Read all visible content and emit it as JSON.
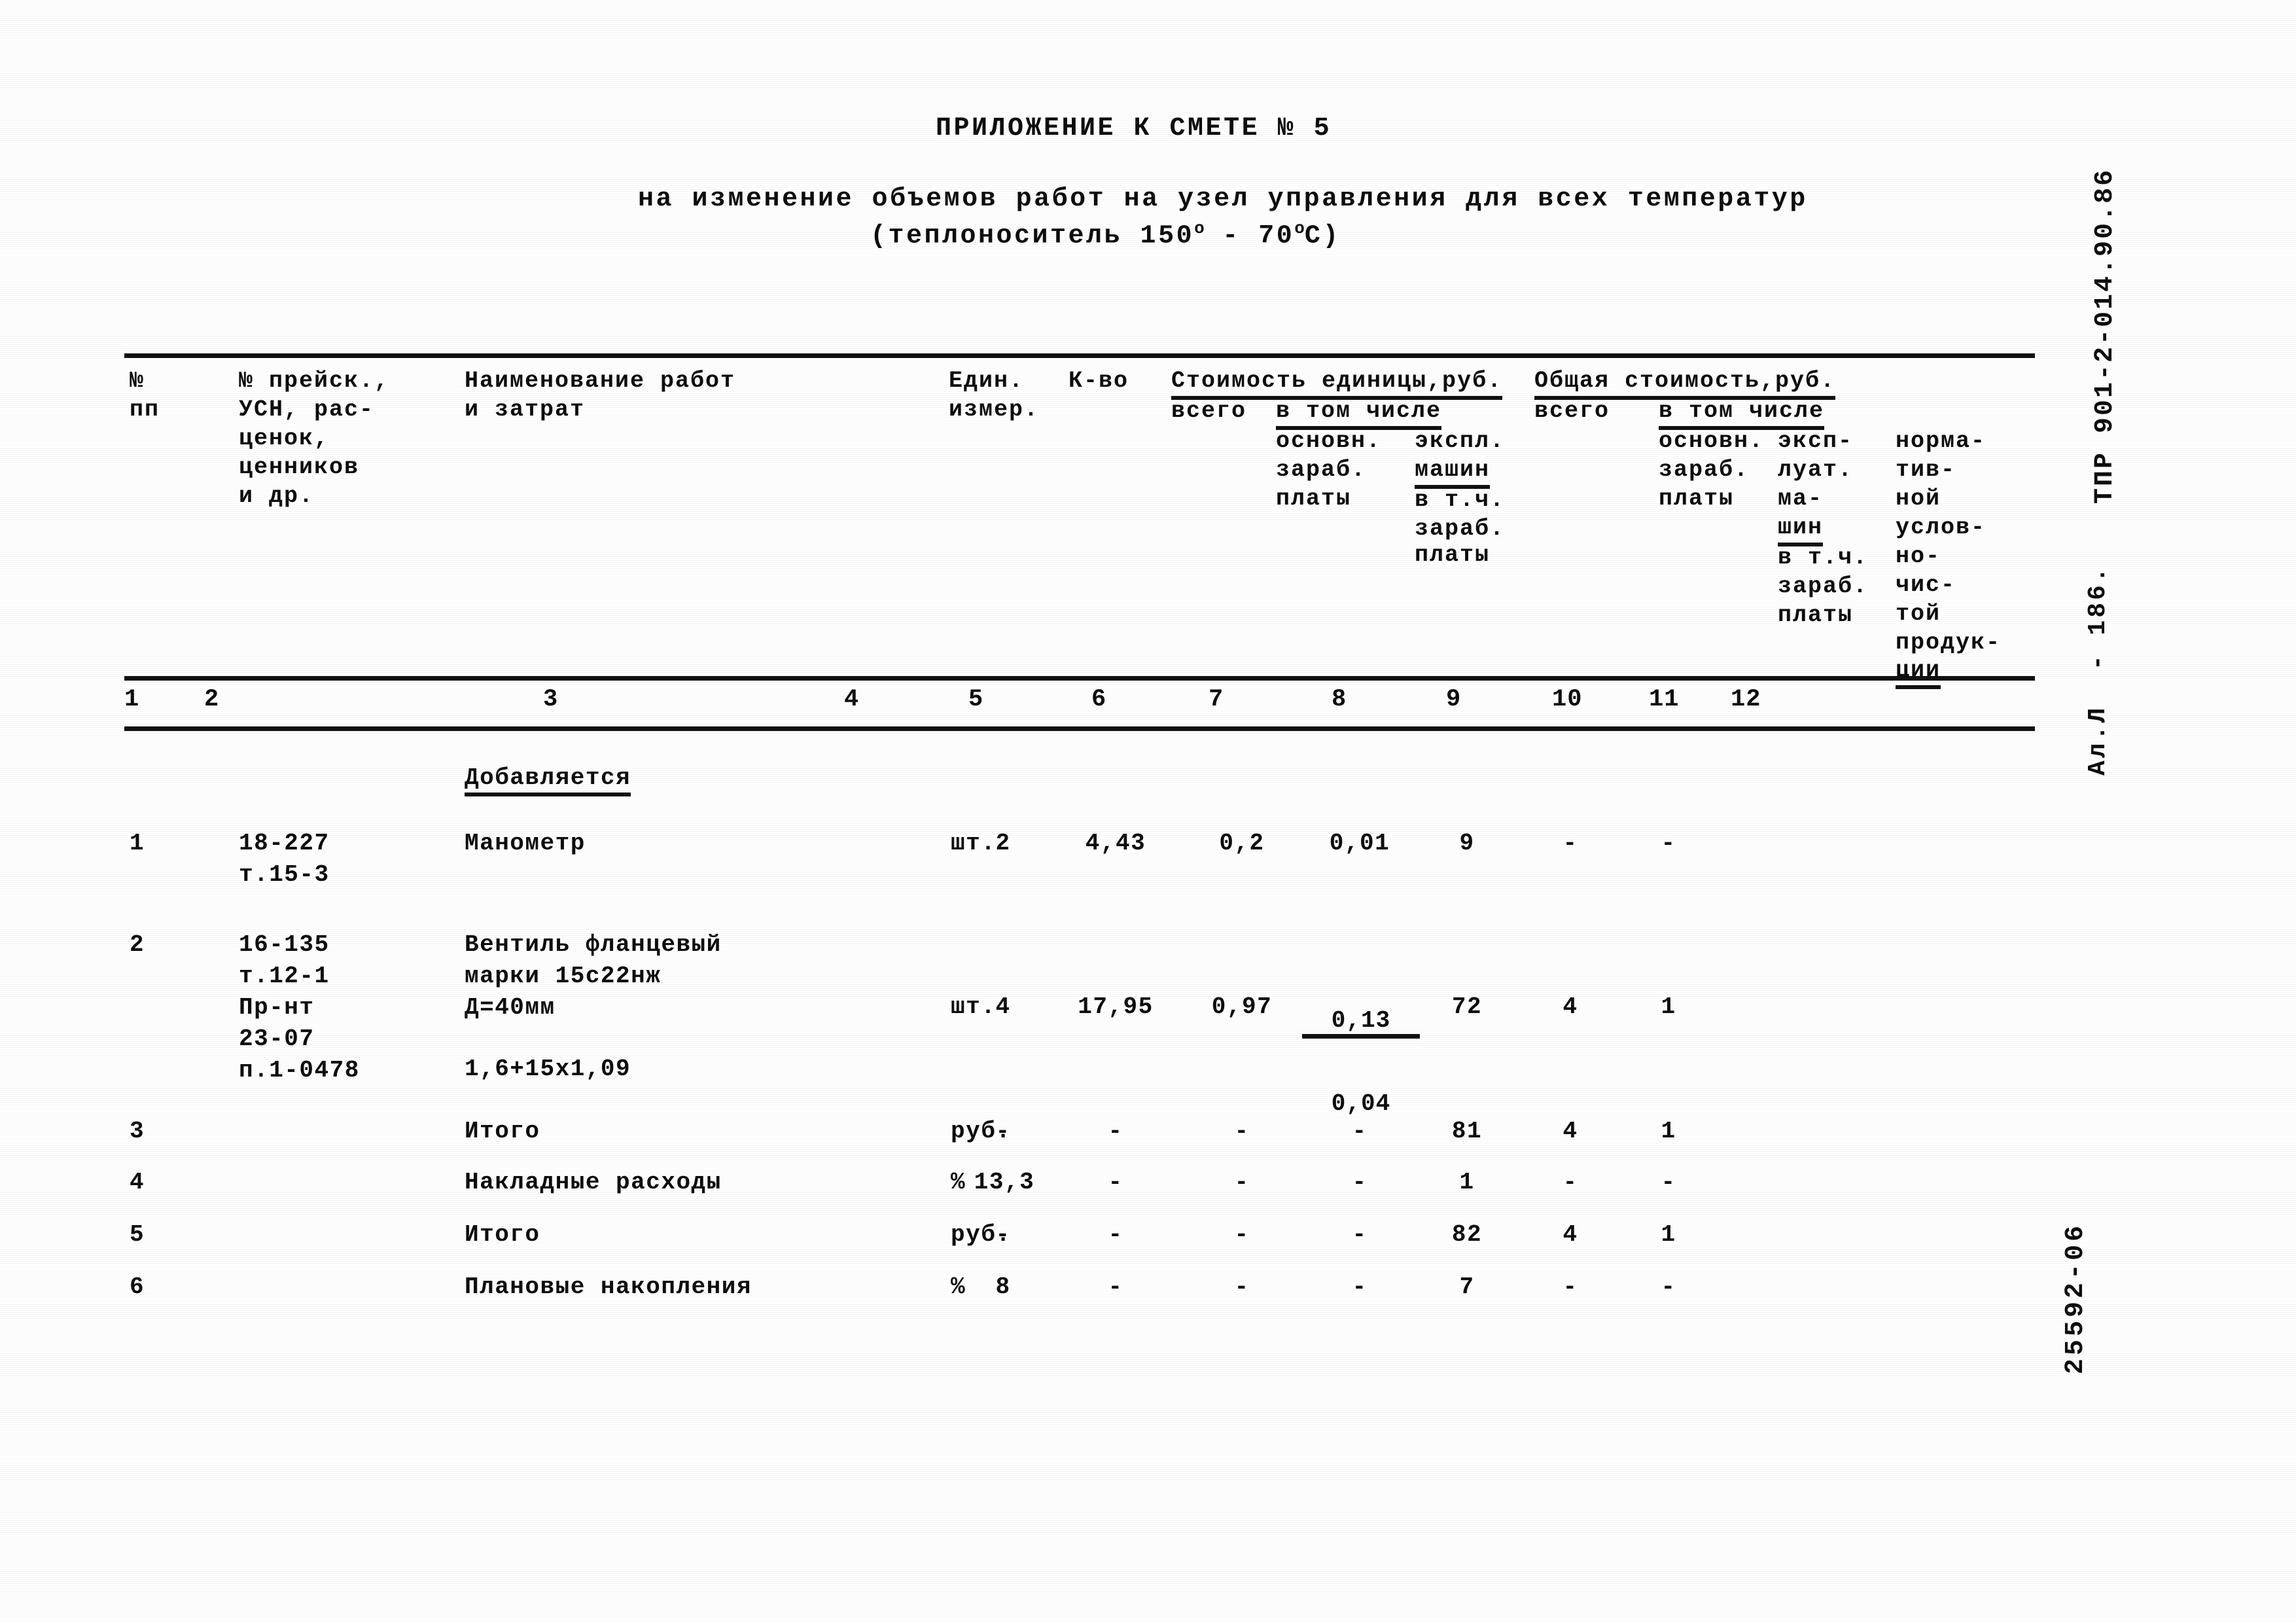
{
  "document": {
    "title": "ПРИЛОЖЕНИЕ К СМЕТЕ № 5",
    "subtitle_line1": "на изменение объемов работ на узел управления для всех температур",
    "subtitle_line2_pre": "(теплоноситель 150",
    "subtitle_line2_mid": " - 70",
    "subtitle_line2_post": "С)",
    "degree": "о"
  },
  "stamps": {
    "code": "ТПР 901-2-014.90.86",
    "album": "Ал.Л  - 186.",
    "archive": "25592-06"
  },
  "table": {
    "header": {
      "col1": "№\nпп",
      "col2": "№ прейск.,\nУСН, рас-\nценок,\nценников\nи др.",
      "col3": "Наименование работ\nи затрат",
      "col4": "Един.\nизмер.",
      "col5": "К-во",
      "group_unit_cost": "Стоимость единицы,руб.",
      "group_total_cost": "Общая стоимость,руб.",
      "col6": "всего",
      "unit_in_which": "в том числе",
      "col7": "основн.\nзараб.\nплаты",
      "col8_l1": "экспл.",
      "col8_l2": "машин",
      "col8_l3": "в т.ч.",
      "col8_l4": "зараб.",
      "col8_l5": "платы",
      "col9": "всего",
      "total_in_which": "в том числе",
      "col10_l1": "основн.",
      "col10_l2": "зараб.",
      "col10_l3": "платы",
      "col11_l1": "эксп-",
      "col11_l2": "луат.",
      "col11_l3": "ма-",
      "col11_l4": "шин",
      "col11_l5": "в т.ч.",
      "col11_l6": "зараб.",
      "col11_l7": "платы",
      "col12_l1": "норма-",
      "col12_l2": "тив-",
      "col12_l3": "ной",
      "col12_l4": "услов-",
      "col12_l5": "но-",
      "col12_l6": "чис-",
      "col12_l7": "той",
      "col12_l8": "продук-",
      "col12_l9": "ции"
    },
    "column_numbers": [
      "1",
      "2",
      "3",
      "4",
      "5",
      "6",
      "7",
      "8",
      "9",
      "10",
      "11",
      "12"
    ],
    "section_label": "Добавляется",
    "rows": [
      {
        "n": "1",
        "code": "18-227\nт.15-3",
        "name": "Манометр",
        "unit": "шт.",
        "qty": "2",
        "u_total": "4,43",
        "u_wage": "0,2",
        "u_mach": "0,01",
        "u_mach_frac": null,
        "t_total": "9",
        "t_wage": "-",
        "t_mach": "-",
        "t_nchp": ""
      },
      {
        "n": "2",
        "code": "16-135\nт.12-1\nПр-нт\n23-07\nп.1-0478",
        "name": "Вентиль фланцевый\nмарки 15с22нж\nД=40мм",
        "name_extra": "1,6+15х1,09",
        "unit": "шт.",
        "qty": "4",
        "u_total": "17,95",
        "u_wage": "0,97",
        "u_mach_frac": {
          "numerator": "0,13",
          "denominator": "0,04"
        },
        "t_total": "72",
        "t_wage": "4",
        "t_mach": "1",
        "t_nchp": ""
      },
      {
        "n": "3",
        "code": "",
        "name": "Итого",
        "unit": "руб.",
        "qty": "-",
        "u_total": "-",
        "u_wage": "-",
        "u_mach": "-",
        "t_total": "81",
        "t_wage": "4",
        "t_mach": "1",
        "t_nchp": ""
      },
      {
        "n": "4",
        "code": "",
        "name": "Накладные расходы",
        "unit": "%",
        "qty": "13,3",
        "u_total": "-",
        "u_wage": "-",
        "u_mach": "-",
        "t_total": "1",
        "t_wage": "-",
        "t_mach": "-",
        "t_nchp": ""
      },
      {
        "n": "5",
        "code": "",
        "name": "Итого",
        "unit": "руб.",
        "qty": "-",
        "u_total": "-",
        "u_wage": "-",
        "u_mach": "-",
        "t_total": "82",
        "t_wage": "4",
        "t_mach": "1",
        "t_nchp": ""
      },
      {
        "n": "6",
        "code": "",
        "name": "Плановые накопления",
        "unit": "%",
        "qty": "8",
        "u_total": "-",
        "u_wage": "-",
        "u_mach": "-",
        "t_total": "7",
        "t_wage": "-",
        "t_mach": "-",
        "t_nchp": ""
      }
    ]
  }
}
